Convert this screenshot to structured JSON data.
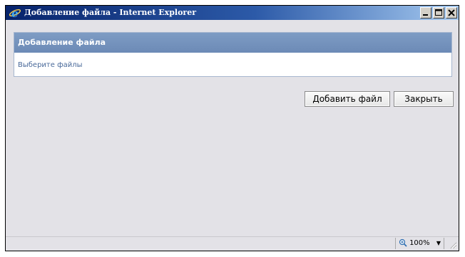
{
  "window": {
    "title": "Добавление файла - Internet Explorer",
    "controls": {
      "minimize": "_",
      "maximize": "□",
      "close": "×"
    }
  },
  "panel": {
    "header": "Добавление файла",
    "link": "Выберите файлы"
  },
  "actions": {
    "add_label": "Добавить файл",
    "close_label": "Закрыть"
  },
  "statusbar": {
    "zoom": "100%",
    "zoom_icon": "magnifier-plus-icon"
  },
  "colors": {
    "titlebar_start": "#07236b",
    "panel_header": "#7e9cc4",
    "link": "#4a6a9a",
    "window_bg": "#e3e2e7"
  }
}
